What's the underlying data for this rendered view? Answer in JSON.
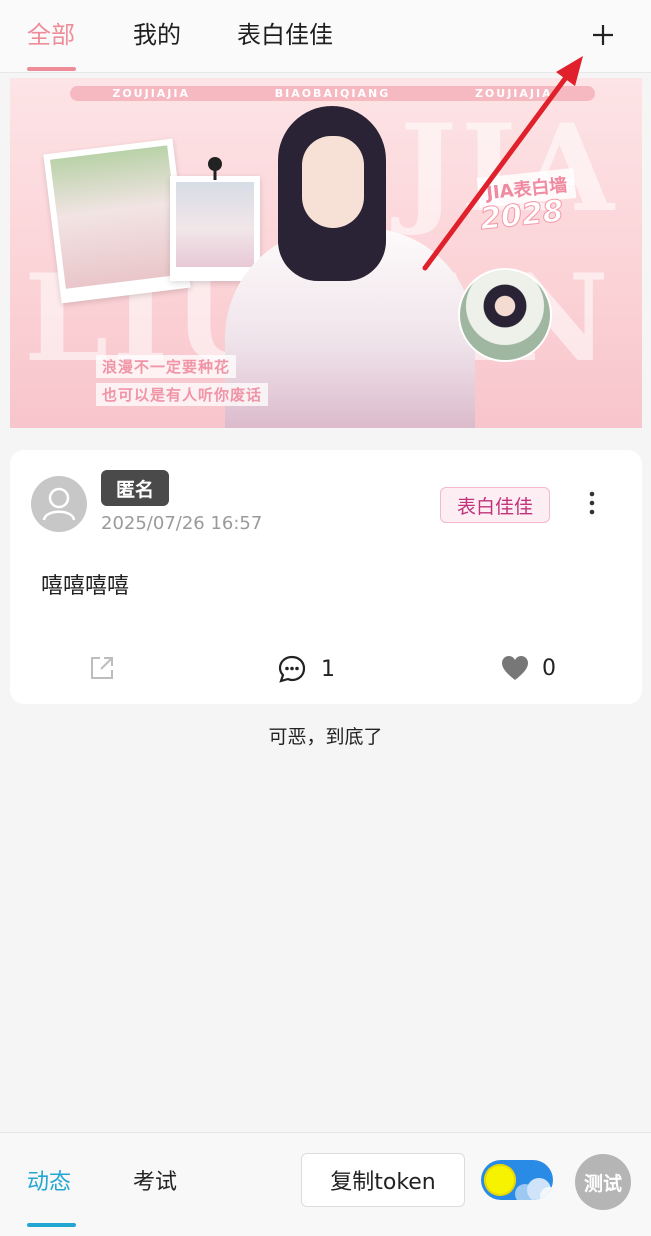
{
  "top_tabs": [
    {
      "label": "全部",
      "active": true
    },
    {
      "label": "我的",
      "active": false
    },
    {
      "label": "表白佳佳",
      "active": false
    }
  ],
  "colors": {
    "accent_pink": "#ee8c99",
    "accent_blue": "#23a7d2",
    "arrow_red": "#e0202a"
  },
  "banner": {
    "ribbon": [
      "ZOUJIAJIA",
      "BIAOBAIQIANG",
      "ZOUJIAJIA"
    ],
    "bg_text_top": "JIA",
    "bg_text_bottom": "LIUJIAN",
    "wall_title": "JIA表白墙",
    "year": "2028",
    "slogan_1": "浪漫不一定要种花",
    "slogan_2": "也可以是有人听你废话"
  },
  "post": {
    "author_badge": "匿名",
    "time": "2025/07/26 16:57",
    "category": "表白佳佳",
    "content": "嘻嘻嘻嘻",
    "comments": "1",
    "likes": "0"
  },
  "end_text": "可恶，到底了",
  "bottom": {
    "tabs": [
      {
        "label": "动态",
        "active": true
      },
      {
        "label": "考试",
        "active": false
      }
    ],
    "copy_token": "复制token",
    "test_button": "测试"
  }
}
